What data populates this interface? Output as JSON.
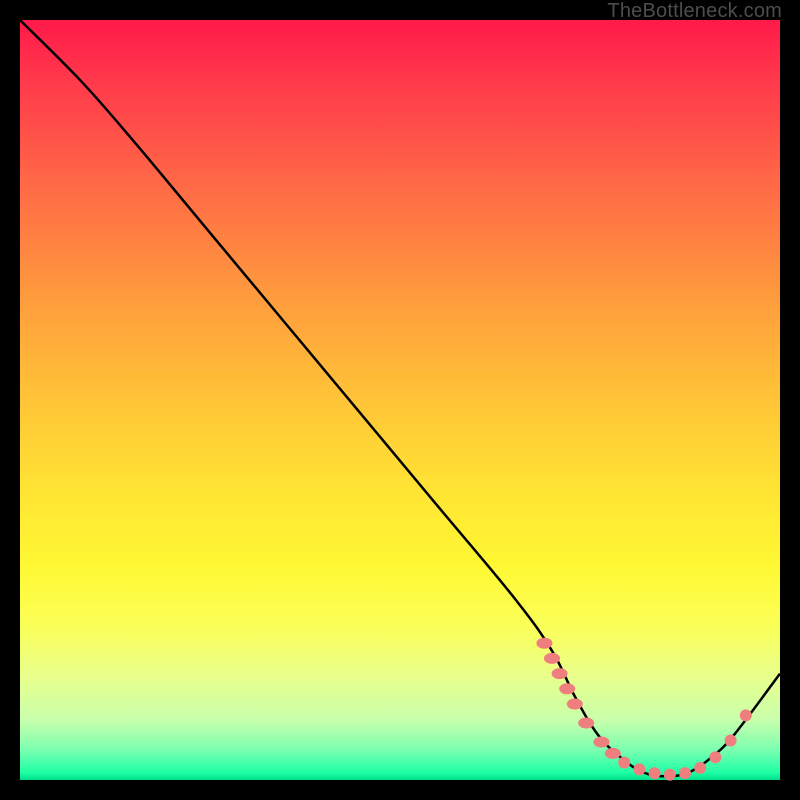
{
  "watermark": "TheBottleneck.com",
  "colors": {
    "background": "#000000",
    "line": "#000000",
    "dot": "#ef7e7f"
  },
  "chart_data": {
    "type": "line",
    "title": "",
    "xlabel": "",
    "ylabel": "",
    "xlim": [
      0,
      100
    ],
    "ylim": [
      0,
      100
    ],
    "grid": false,
    "series": [
      {
        "name": "curve",
        "x": [
          0,
          8,
          15,
          25,
          35,
          45,
          55,
          65,
          70,
          73,
          76,
          79,
          82,
          85,
          88,
          91,
          94,
          100
        ],
        "y": [
          100,
          92,
          84,
          72,
          60,
          48,
          36,
          24,
          17,
          11,
          6,
          3,
          1,
          0.5,
          1,
          3,
          6,
          14
        ]
      }
    ],
    "markers": {
      "name": "dots",
      "x": [
        69,
        70,
        71,
        72,
        73,
        74.5,
        76.5,
        78,
        79.5,
        81.5,
        83.5,
        85.5,
        87.5,
        89.5,
        91.5,
        93.5,
        95.5
      ],
      "y": [
        18,
        16,
        14,
        12,
        10,
        7.5,
        5,
        3.5,
        2.3,
        1.4,
        0.9,
        0.7,
        0.9,
        1.6,
        3,
        5.2,
        8.5
      ],
      "flatCount": 8
    }
  }
}
